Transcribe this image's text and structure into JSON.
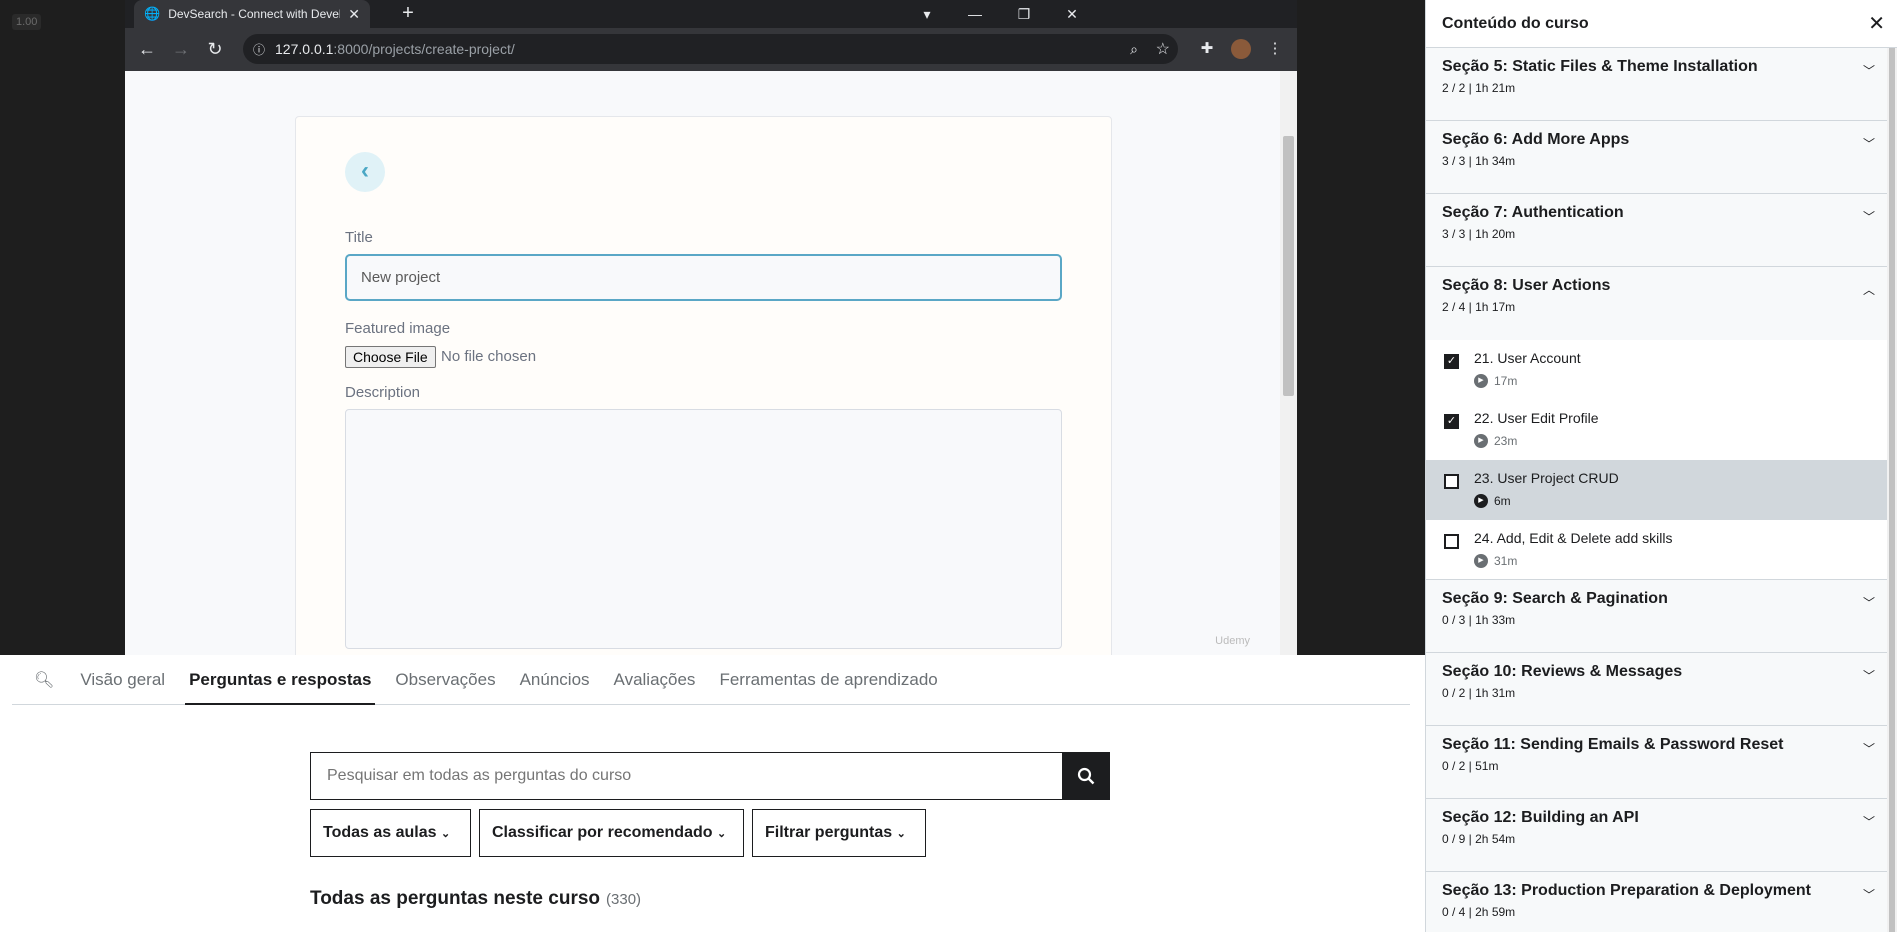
{
  "video": {
    "zoom": "1.00",
    "browser": {
      "tab_title": "DevSearch - Connect with Develo",
      "url_host": "127.0.0.1",
      "url_path": ":8000/projects/create-project/"
    },
    "page": {
      "title_label": "Title",
      "title_value": "New project",
      "image_label": "Featured image",
      "choose_file": "Choose File",
      "no_file": "No file chosen",
      "description_label": "Description",
      "watermark": "Udemy"
    }
  },
  "lower_tabs": [
    "Visão geral",
    "Perguntas e respostas",
    "Observações",
    "Anúncios",
    "Avaliações",
    "Ferramentas de aprendizado"
  ],
  "qa": {
    "search_placeholder": "Pesquisar em todas as perguntas do curso",
    "filter1": "Todas as aulas",
    "filter2": "Classificar por recomendado",
    "filter3": "Filtrar perguntas",
    "all_title": "Todas as perguntas neste curso",
    "all_count": "(330)"
  },
  "sidebar": {
    "title": "Conteúdo do curso",
    "sections": [
      {
        "name": "Seção 5: Static Files & Theme Installation",
        "meta": "2 / 2 | 1h 21m"
      },
      {
        "name": "Seção 6: Add More Apps",
        "meta": "3 / 3 | 1h 34m"
      },
      {
        "name": "Seção 7: Authentication",
        "meta": "3 / 3 | 1h 20m"
      },
      {
        "name": "Seção 8: User Actions",
        "meta": "2 / 4 | 1h 17m"
      },
      {
        "name": "Seção 9: Search & Pagination",
        "meta": "0 / 3 | 1h 33m"
      },
      {
        "name": "Seção 10: Reviews & Messages",
        "meta": "0 / 2 | 1h 31m"
      },
      {
        "name": "Seção 11: Sending Emails & Password Reset",
        "meta": "0 / 2 | 51m"
      },
      {
        "name": "Seção 12: Building an API",
        "meta": "0 / 9 | 2h 54m"
      },
      {
        "name": "Seção 13: Production Preparation & Deployment",
        "meta": "0 / 4 | 2h 59m"
      }
    ],
    "lectures": [
      {
        "title": "21. User Account",
        "duration": "17m",
        "done": true
      },
      {
        "title": "22. User Edit Profile",
        "duration": "23m",
        "done": true
      },
      {
        "title": "23. User Project CRUD",
        "duration": "6m",
        "done": false
      },
      {
        "title": "24. Add, Edit & Delete add skills",
        "duration": "31m",
        "done": false
      }
    ]
  }
}
